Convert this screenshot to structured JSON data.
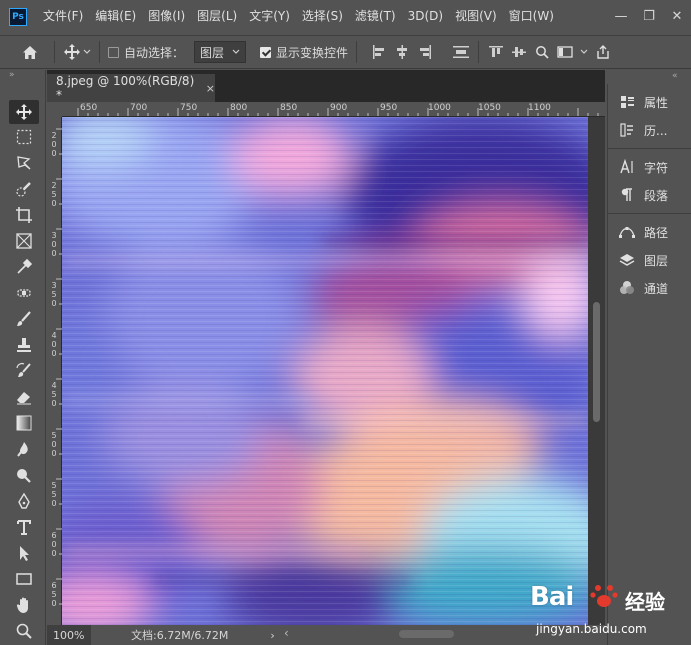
{
  "app": {
    "logo": "Ps"
  },
  "menu": [
    "文件(F)",
    "编辑(E)",
    "图像(I)",
    "图层(L)",
    "文字(Y)",
    "选择(S)",
    "滤镜(T)",
    "3D(D)",
    "视图(V)",
    "窗口(W)"
  ],
  "window_controls": {
    "minimize": "—",
    "restore": "❐",
    "close": "✕"
  },
  "options_bar": {
    "auto_select_label": "自动选择：",
    "auto_select_checked": false,
    "layer_select_value": "图层",
    "show_transform_label": "显示变换控件",
    "show_transform_checked": true
  },
  "document": {
    "tab_title": "8.jpeg @ 100%(RGB/8) *",
    "tab_close": "×",
    "ruler_top_labels": [
      "650",
      "700",
      "750",
      "800",
      "850",
      "900",
      "950",
      "1000",
      "1050",
      "1100"
    ],
    "ruler_left_labels": [
      "2\n0\n0",
      "2\n5\n0",
      "3\n0\n0",
      "3\n5\n0",
      "4\n0\n0",
      "4\n5\n0",
      "5\n0\n0",
      "5\n5\n0",
      "6\n0\n0",
      "6\n5\n0"
    ],
    "zoom": "100%",
    "doc_info": "文档:6.72M/6.72M",
    "status_arrow": "›",
    "scroll_left_arrow": "‹"
  },
  "panels": {
    "group1": [
      {
        "icon": "properties-icon",
        "label": "属性"
      },
      {
        "icon": "history-icon",
        "label": "历..."
      }
    ],
    "group2": [
      {
        "icon": "character-icon",
        "label": "字符"
      },
      {
        "icon": "paragraph-icon",
        "label": "段落"
      }
    ],
    "group3": [
      {
        "icon": "paths-icon",
        "label": "路径"
      },
      {
        "icon": "layers-icon",
        "label": "图层"
      },
      {
        "icon": "channels-icon",
        "label": "通道"
      }
    ]
  },
  "watermark": {
    "brand": "Bai",
    "brand2": "经验",
    "url": "jingyan.baidu.com"
  },
  "colors": {
    "ui_bg": "#535353",
    "canvas_base": "#6c6fd6",
    "ps_accent": "#31a8ff"
  }
}
